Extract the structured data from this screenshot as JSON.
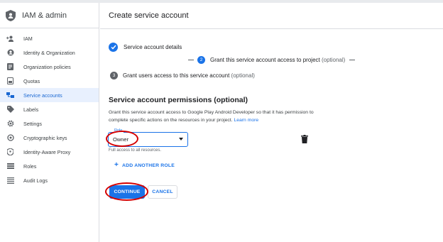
{
  "sidebar": {
    "title": "IAM & admin",
    "items": [
      {
        "label": "IAM",
        "icon": "add-person-icon",
        "active": false
      },
      {
        "label": "Identity & Organization",
        "icon": "account-circle-icon",
        "active": false
      },
      {
        "label": "Organization policies",
        "icon": "policy-document-icon",
        "active": false
      },
      {
        "label": "Quotas",
        "icon": "quota-icon",
        "active": false
      },
      {
        "label": "Service accounts",
        "icon": "service-account-icon",
        "active": true
      },
      {
        "label": "Labels",
        "icon": "label-tag-icon",
        "active": false
      },
      {
        "label": "Settings",
        "icon": "gear-icon",
        "active": false
      },
      {
        "label": "Cryptographic keys",
        "icon": "crypto-key-icon",
        "active": false
      },
      {
        "label": "Identity-Aware Proxy",
        "icon": "shield-proxy-icon",
        "active": false
      },
      {
        "label": "Roles",
        "icon": "roles-icon",
        "active": false
      },
      {
        "label": "Audit Logs",
        "icon": "list-lines-icon",
        "active": false
      }
    ]
  },
  "main": {
    "title": "Create service account",
    "steps": [
      {
        "number": "",
        "label": "Service account details",
        "optional": ""
      },
      {
        "number": "2",
        "label": "Grant this service account access to project",
        "optional": "(optional)"
      },
      {
        "number": "3",
        "label": "Grant users access to this service account",
        "optional": "(optional)"
      }
    ],
    "permissions": {
      "title": "Service account permissions (optional)",
      "description": "Grant this service account access to Google Play Android Developer so that it has permission to complete specific actions on the resources in your project.",
      "learn_more": "Learn more",
      "role_label": "Role",
      "role_value": "Owner",
      "role_hint": "Full access to all resources.",
      "add_role": "ADD ANOTHER ROLE"
    },
    "buttons": {
      "continue": "CONTINUE",
      "cancel": "CANCEL"
    }
  },
  "colors": {
    "accent": "#1a73e8",
    "active_bg": "#e8f0fe",
    "annotation_red": "#d50000"
  }
}
